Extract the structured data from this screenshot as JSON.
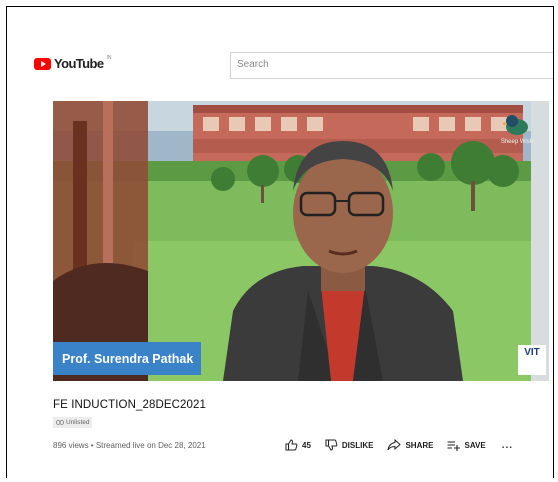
{
  "masthead": {
    "logo_text": "YouTube",
    "region_code": "IN",
    "search_placeholder": "Search"
  },
  "video": {
    "presenter_name": "Prof. Surendra Pathak",
    "channel_badge_text": "Sheep Wish",
    "institution_badge": "VIT"
  },
  "info": {
    "title": "FE INDUCTION_28DEC2021",
    "privacy_label": "Unlisted",
    "views_line": "896 views • Streamed live on Dec 28, 2021"
  },
  "actions": {
    "like_count": "45",
    "dislike_label": "DISLIKE",
    "share_label": "SHARE",
    "save_label": "SAVE",
    "more_label": "..."
  },
  "colors": {
    "brand_red": "#ff0000",
    "nametag_blue": "#3a83c9"
  },
  "icons": [
    "youtube-logo-icon",
    "thumbs-up-icon",
    "thumbs-down-icon",
    "share-arrow-icon",
    "add-to-playlist-icon",
    "more-icon",
    "link-icon"
  ]
}
